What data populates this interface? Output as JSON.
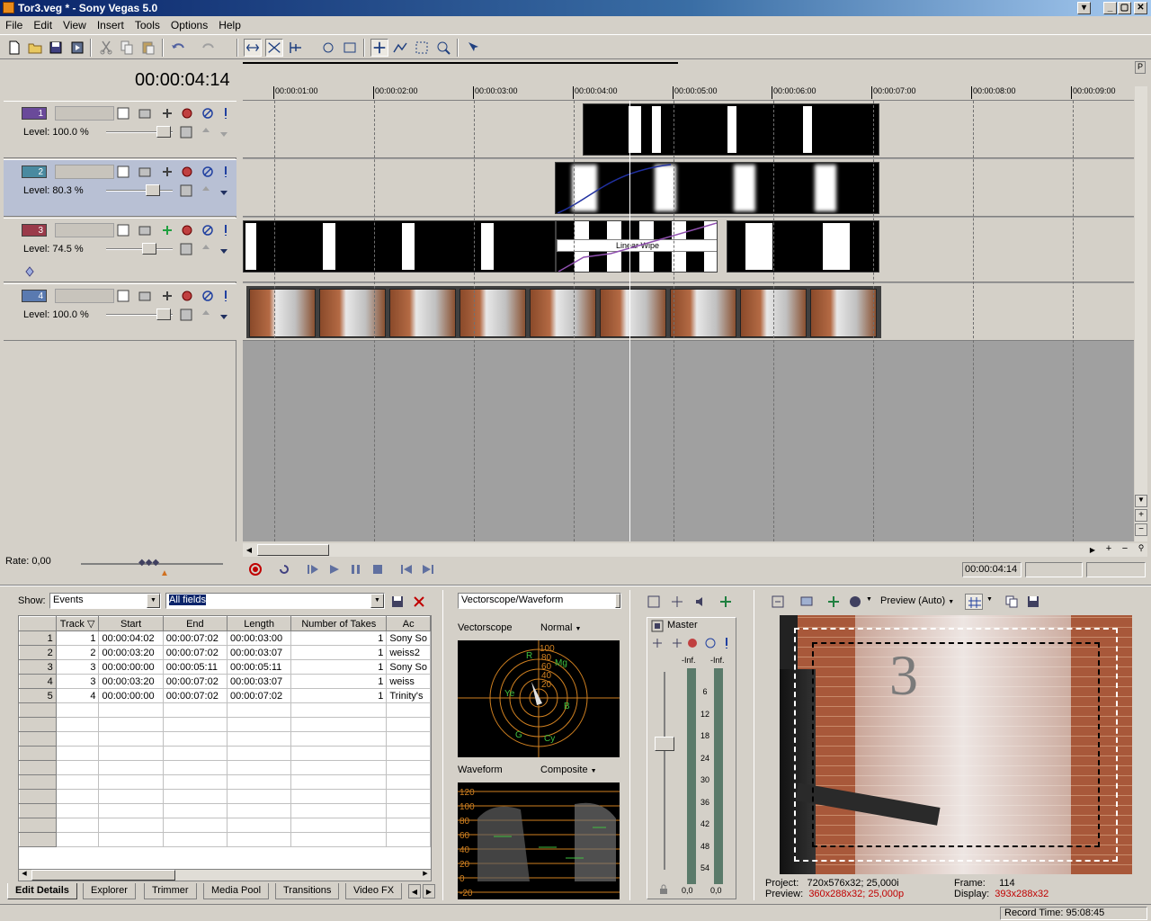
{
  "window": {
    "title": "Tor3.veg * - Sony Vegas 5.0",
    "btn_min": "_",
    "btn_max": "▢",
    "btn_close": "✕"
  },
  "menu": [
    "File",
    "Edit",
    "View",
    "Insert",
    "Tools",
    "Options",
    "Help"
  ],
  "timecode": "00:00:04:14",
  "ruler": [
    "00:00:01:00",
    "00:00:02:00",
    "00:00:03:00",
    "00:00:04:00",
    "00:00:05:00",
    "00:00:06:00",
    "00:00:07:00",
    "00:00:08:00",
    "00:00:09:00"
  ],
  "tracks": [
    {
      "number": "1",
      "level": "Level: 100.0 %",
      "level_value": 1.0,
      "color": "#6a4a9a"
    },
    {
      "number": "2",
      "level": "Level:  80.3 %",
      "level_value": 0.803,
      "color": "#4a8aa0"
    },
    {
      "number": "3",
      "level": "Level:  74.5 %",
      "level_value": 0.745,
      "color": "#9a3a4a"
    },
    {
      "number": "4",
      "level": "Level: 100.0 %",
      "level_value": 1.0,
      "color": "#5a7ab0"
    }
  ],
  "transition_label": "Linear Wipe",
  "rate": "Rate: 0,00",
  "transport_timecode": "00:00:04:14",
  "edit_details": {
    "show_label": "Show:",
    "show_value": "Events",
    "fields_value": "All fields",
    "columns": [
      "Track",
      "Start",
      "End",
      "Length",
      "Number of Takes",
      "Ac"
    ],
    "rows": [
      {
        "n": "1",
        "track": "1",
        "start": "00:00:04:02",
        "end": "00:00:07:02",
        "length": "00:00:03:00",
        "takes": "1",
        "active": "Sony So"
      },
      {
        "n": "2",
        "track": "2",
        "start": "00:00:03:20",
        "end": "00:00:07:02",
        "length": "00:00:03:07",
        "takes": "1",
        "active": "weiss2"
      },
      {
        "n": "3",
        "track": "3",
        "start": "00:00:00:00",
        "end": "00:00:05:11",
        "length": "00:00:05:11",
        "takes": "1",
        "active": "Sony So"
      },
      {
        "n": "4",
        "track": "3",
        "start": "00:00:03:20",
        "end": "00:00:07:02",
        "length": "00:00:03:07",
        "takes": "1",
        "active": "weiss"
      },
      {
        "n": "5",
        "track": "4",
        "start": "00:00:00:00",
        "end": "00:00:07:02",
        "length": "00:00:07:02",
        "takes": "1",
        "active": "Trinity's"
      }
    ]
  },
  "tabs": [
    "Edit Details",
    "Explorer",
    "Trimmer",
    "Media Pool",
    "Transitions",
    "Video FX"
  ],
  "scopes": {
    "selector": "Vectorscope/Waveform",
    "vectorscope_label": "Vectorscope",
    "vectorscope_mode": "Normal",
    "vs_rings": [
      "100",
      "80",
      "60",
      "40",
      "20"
    ],
    "vs_targets": [
      "R",
      "Mg",
      "Ye",
      "B",
      "G",
      "Cy"
    ],
    "waveform_label": "Waveform",
    "waveform_mode": "Composite",
    "wf_scale": [
      "120",
      "100",
      "80",
      "60",
      "40",
      "20",
      "0",
      "-20"
    ]
  },
  "mixer": {
    "master": "Master",
    "peak_l": "-Inf.",
    "peak_r": "-Inf.",
    "db_scale": [
      "6",
      "12",
      "18",
      "24",
      "30",
      "36",
      "42",
      "48",
      "54"
    ],
    "val_l": "0,0",
    "val_r": "0,0"
  },
  "preview": {
    "mode": "Preview (Auto)",
    "project_label": "Project:",
    "project_value": "720x576x32; 25,000i",
    "preview_label": "Preview:",
    "preview_value": "360x288x32; 25,000p",
    "frame_label": "Frame:",
    "frame_value": "114",
    "display_label": "Display:",
    "display_value": "393x288x32",
    "record_time": "Record Time: 95:08:45",
    "door_number": "3"
  },
  "colors": {
    "accent_red": "#c00000",
    "selection": "#0a246a",
    "scope_orange": "#d08020",
    "scope_green": "#40c040"
  }
}
